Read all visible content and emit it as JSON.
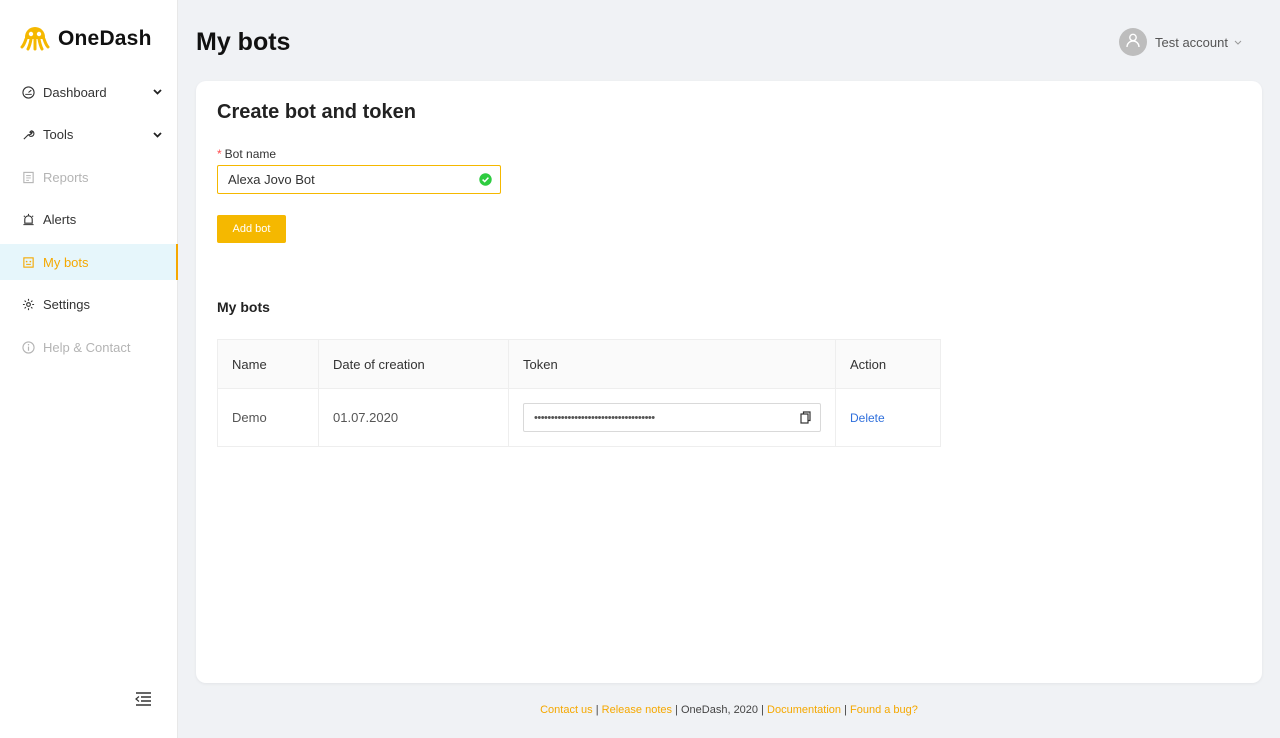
{
  "app": {
    "name": "OneDash"
  },
  "colors": {
    "accent": "#f5b800",
    "active_bg": "#e6f6fb",
    "link": "#2f6fdc",
    "success": "#2ecc40"
  },
  "sidebar": {
    "items": [
      {
        "label": "Dashboard",
        "icon": "gauge-icon",
        "has_chevron": true,
        "disabled": false,
        "active": false
      },
      {
        "label": "Tools",
        "icon": "wrench-icon",
        "has_chevron": true,
        "disabled": false,
        "active": false
      },
      {
        "label": "Reports",
        "icon": "report-icon",
        "has_chevron": false,
        "disabled": true,
        "active": false
      },
      {
        "label": "Alerts",
        "icon": "alarm-icon",
        "has_chevron": false,
        "disabled": false,
        "active": false
      },
      {
        "label": "My bots",
        "icon": "bot-icon",
        "has_chevron": false,
        "disabled": false,
        "active": true
      },
      {
        "label": "Settings",
        "icon": "gear-icon",
        "has_chevron": false,
        "disabled": false,
        "active": false
      },
      {
        "label": "Help & Contact",
        "icon": "info-icon",
        "has_chevron": false,
        "disabled": true,
        "active": false
      }
    ]
  },
  "header": {
    "title": "My bots",
    "account": "Test account"
  },
  "form": {
    "title": "Create bot and token",
    "required_mark": "*",
    "bot_name_label": "Bot name",
    "bot_name_value": "Alexa Jovo Bot",
    "add_button": "Add bot"
  },
  "bots": {
    "title": "My bots",
    "columns": [
      "Name",
      "Date of creation",
      "Token",
      "Action"
    ],
    "rows": [
      {
        "name": "Demo",
        "date": "01.07.2020",
        "token": "••••••••••••••••••••••••••••••••••••",
        "action": "Delete"
      }
    ]
  },
  "footer": {
    "contact": "Contact us",
    "sep1": " | ",
    "release": "Release notes",
    "sep2": " | ",
    "copyright": "OneDash, 2020",
    "sep3": " | ",
    "docs": "Documentation",
    "sep4": " | ",
    "bug": "Found a bug?"
  }
}
